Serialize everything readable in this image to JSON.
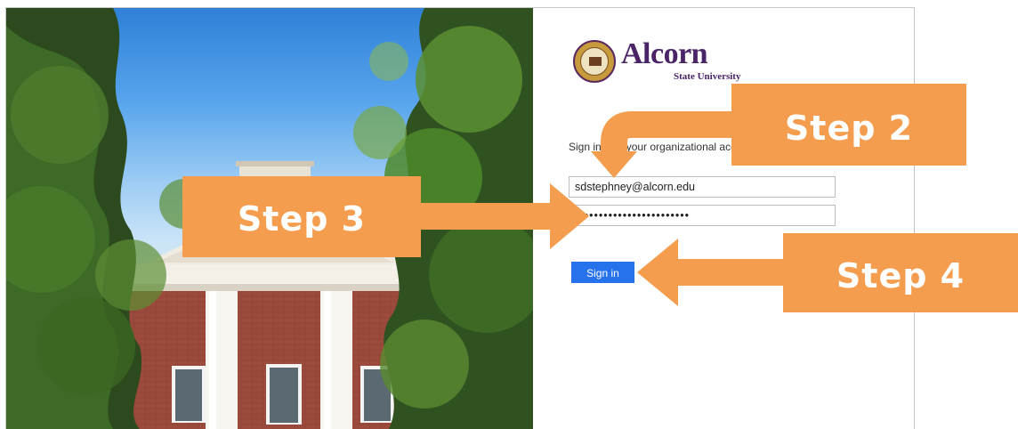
{
  "login": {
    "logo": {
      "name": "Alcorn",
      "subtitle": "State University"
    },
    "instruction": "Sign in with your organizational account",
    "email_value": "sdstephney@alcorn.edu",
    "password_value": "••••••••••••••••••••••••",
    "signin_label": "Sign in",
    "button_color": "#2672ec",
    "brand_color": "#4b2468"
  },
  "annotations": {
    "step2": "Step 2",
    "step3": "Step 3",
    "step4": "Step 4",
    "color": "#f59d4e"
  }
}
